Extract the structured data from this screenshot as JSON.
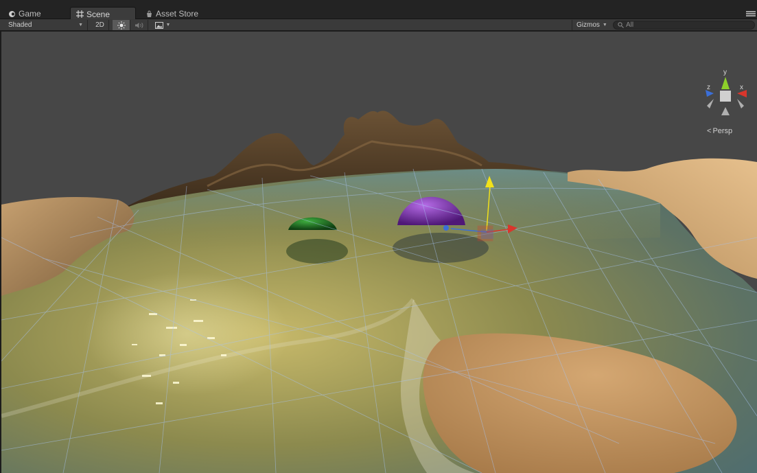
{
  "tabs": [
    {
      "label": "Game",
      "icon": "game-controller-icon",
      "active": false
    },
    {
      "label": "Scene",
      "icon": "scene-grid-icon",
      "active": true
    },
    {
      "label": "Asset Store",
      "icon": "asset-store-icon",
      "active": false
    }
  ],
  "toolbar": {
    "shading_mode": "Shaded",
    "mode_2d_label": "2D",
    "lighting_icon": "sun-icon",
    "audio_icon": "speaker-icon",
    "effects_icon": "image-effects-icon",
    "gizmos_label": "Gizmos",
    "search_placeholder": "All"
  },
  "scene_gizmo": {
    "axis_y": "y",
    "axis_x": "x",
    "axis_z": "z",
    "projection_label": "Persp"
  },
  "colors": {
    "viewport_bg": "#474747",
    "toolbar_bg": "#3a3a3a",
    "axis_x": "#d9362c",
    "axis_y": "#8ed02a",
    "axis_z": "#3b6fd8",
    "move_handle_y": "#f2e11a",
    "sphere_green": "#1f6b1f",
    "sphere_purple": "#8a3ec4"
  }
}
